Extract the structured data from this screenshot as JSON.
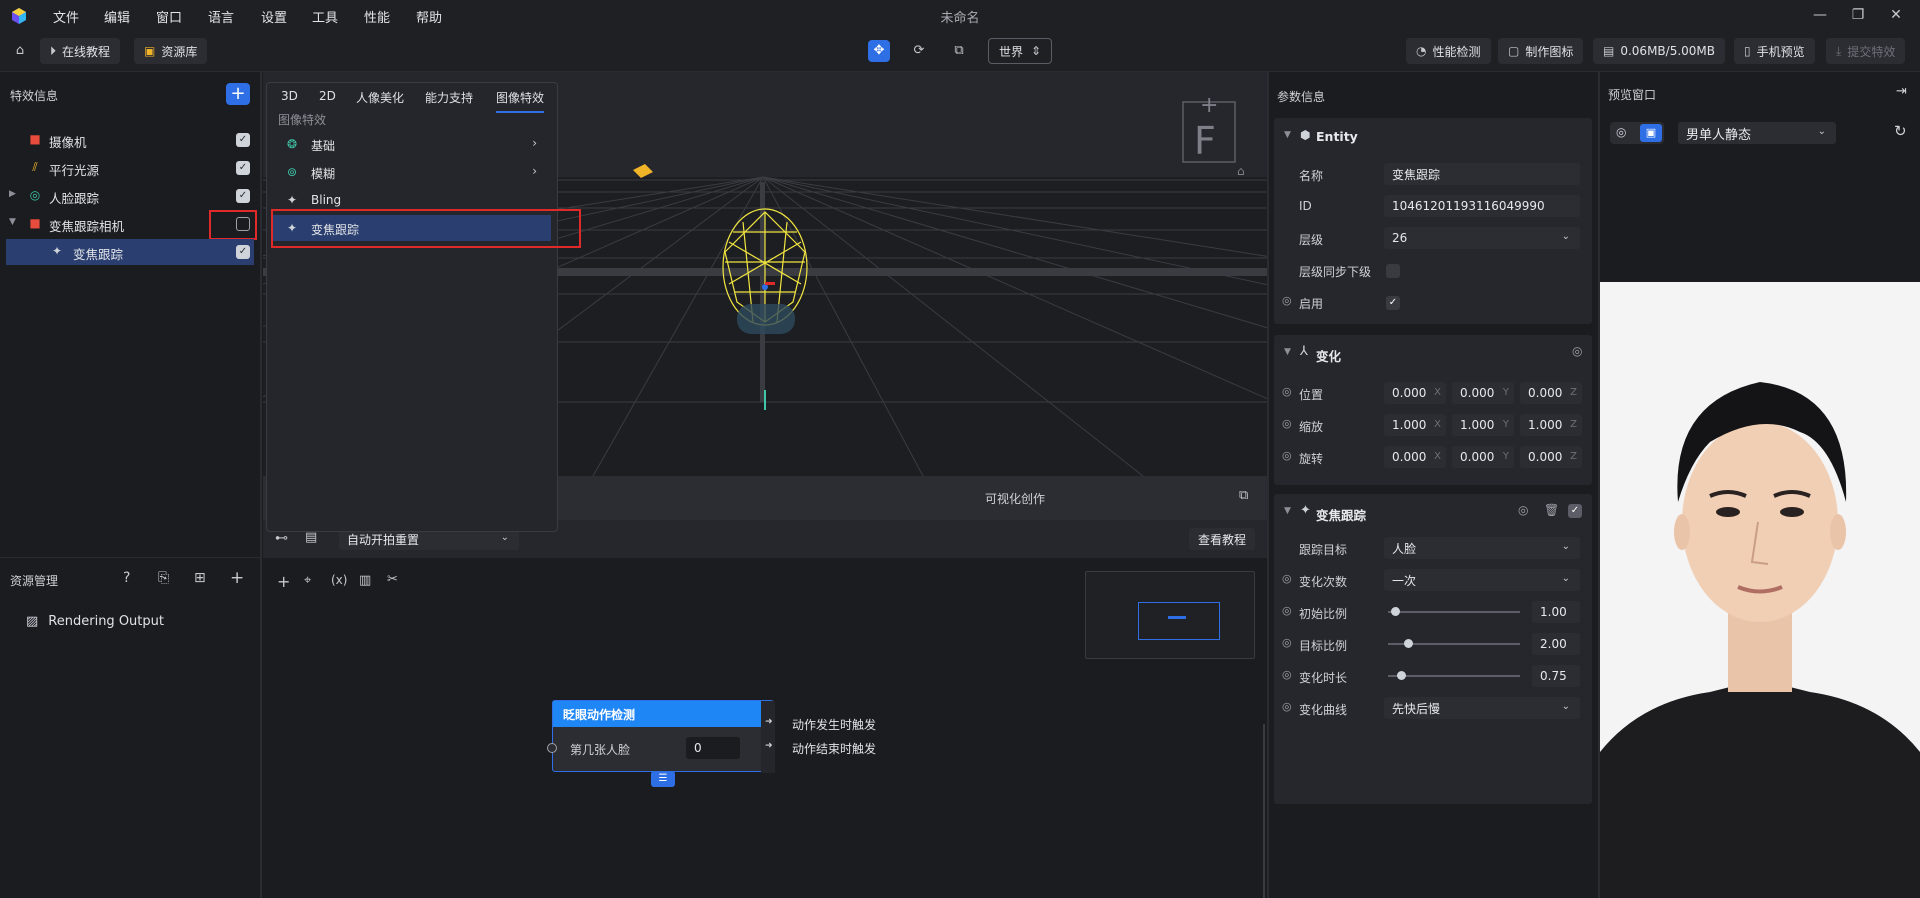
{
  "window": {
    "title": "未命名",
    "minimize": "—",
    "restore": "❐",
    "close": "✕"
  },
  "menu": [
    "文件",
    "编辑",
    "窗口",
    "语言",
    "设置",
    "工具",
    "性能",
    "帮助"
  ],
  "toolbar": {
    "online_tutorial": "在线教程",
    "asset_library": "资源库",
    "space_select": "世界",
    "perf_check": "性能检测",
    "make_icon": "制作图标",
    "memory": "0.06MB/5.00MB",
    "phone_preview": "手机预览",
    "submit_effect": "提交特效"
  },
  "effects_panel": {
    "title": "特效信息",
    "add": "+",
    "items": [
      {
        "label": "摄像机",
        "icon": "camera-icon",
        "checked": true
      },
      {
        "label": "平行光源",
        "icon": "directional-light-icon",
        "checked": true
      },
      {
        "label": "人脸跟踪",
        "icon": "face-tracking-icon",
        "checked": true
      },
      {
        "label": "变焦跟踪相机",
        "icon": "camera-icon",
        "checked": false
      },
      {
        "label": "变焦跟踪",
        "icon": "zoom-tracking-icon",
        "checked": true
      }
    ]
  },
  "asset_panel": {
    "title": "资源管理",
    "items": [
      {
        "label": "Rendering Output",
        "icon": "rendering-output-icon"
      }
    ]
  },
  "dropdown": {
    "tabs": [
      "3D",
      "2D",
      "人像美化",
      "能力支持",
      "图像特效"
    ],
    "active_tab": "图像特效",
    "section": "图像特效",
    "items": [
      {
        "label": "基础",
        "icon": "basic-effect-icon",
        "submenu": true
      },
      {
        "label": "模糊",
        "icon": "blur-icon",
        "submenu": true
      },
      {
        "label": "Bling",
        "icon": "bling-icon",
        "submenu": false
      },
      {
        "label": "变焦跟踪",
        "icon": "zoom-tracking-icon",
        "submenu": false
      }
    ]
  },
  "viewport": {
    "gizmo_letter": "F",
    "plus_mark": "+"
  },
  "visual_panel": {
    "title": "可视化创作",
    "auto_reset": "自动开拍重置",
    "view_tutorial": "查看教程",
    "node": {
      "title": "眨眼动作检测",
      "input_label": "第几张人脸",
      "input_value": "0",
      "out1": "动作发生时触发",
      "out2": "动作结束时触发"
    }
  },
  "params": {
    "title": "参数信息",
    "entity": {
      "title": "Entity",
      "name_label": "名称",
      "name": "变焦跟踪",
      "id_label": "ID",
      "id": "10461201193116049990",
      "layer_label": "层级",
      "layer": "26",
      "sync_label": "层级同步下级",
      "enable_label": "启用"
    },
    "transform": {
      "title": "变化",
      "position_label": "位置",
      "position": [
        "0.000",
        "0.000",
        "0.000"
      ],
      "scale_label": "缩放",
      "scale": [
        "1.000",
        "1.000",
        "1.000"
      ],
      "rotation_label": "旋转",
      "rotation": [
        "0.000",
        "0.000",
        "0.000"
      ],
      "axes": [
        "X",
        "Y",
        "Z"
      ]
    },
    "zoom": {
      "title": "变焦跟踪",
      "target_label": "跟踪目标",
      "target": "人脸",
      "count_label": "变化次数",
      "count": "一次",
      "start_label": "初始比例",
      "start": "1.00",
      "start_frac": 0.02,
      "end_label": "目标比例",
      "end": "2.00",
      "end_frac": 0.12,
      "duration_label": "变化时长",
      "duration": "0.75",
      "duration_frac": 0.07,
      "curve_label": "变化曲线",
      "curve": "先快后慢"
    }
  },
  "preview": {
    "title": "预览窗口",
    "mode": "男单人静态"
  }
}
